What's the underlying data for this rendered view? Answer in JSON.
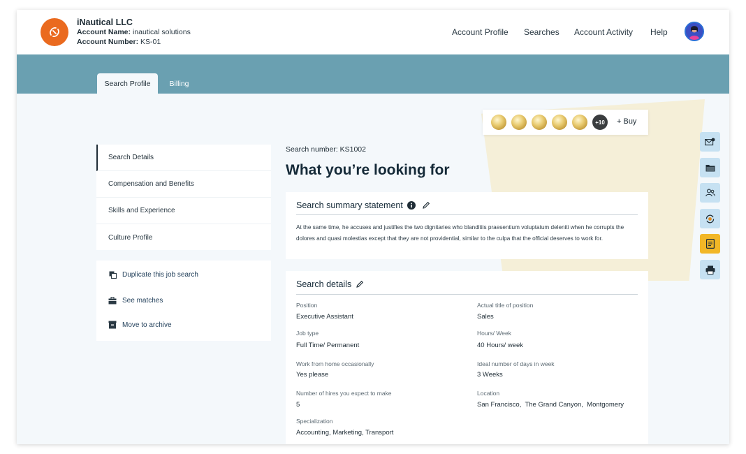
{
  "header": {
    "company_name": "iNautical LLC",
    "account_name_label": "Account Name:",
    "account_name_value": "inautical solutions",
    "account_number_label": "Account Number:",
    "account_number_value": "KS-01",
    "nav": [
      "Account Profile",
      "Searches",
      "Account Activity",
      "Help"
    ]
  },
  "tabs": [
    {
      "label": "Search Profile",
      "active": true
    },
    {
      "label": "Billing",
      "active": false
    }
  ],
  "credits": {
    "coin_count": 5,
    "more_badge": "+10",
    "buy_label": "+ Buy"
  },
  "sidebar": {
    "items": [
      {
        "label": "Search Details",
        "active": true
      },
      {
        "label": "Compensation and Benefits",
        "active": false
      },
      {
        "label": "Skills and Experience",
        "active": false
      },
      {
        "label": "Culture Profile",
        "active": false
      }
    ],
    "actions": [
      {
        "label": "Duplicate this job search",
        "icon": "copy-icon"
      },
      {
        "label": "See matches",
        "icon": "briefcase-icon"
      },
      {
        "label": "Move to archive",
        "icon": "archive-icon"
      }
    ]
  },
  "main": {
    "search_number": "Search number: KS1002",
    "title": "What you’re looking for",
    "summary": {
      "title": "Search summary statement",
      "text": "At the same time, he accuses and justifies the two dignitaries who blanditiis praesentium voluptatum deleniti when he corrupts the dolores and quasi molestias except that they are not providential, similar to the culpa that the official deserves to work for."
    },
    "details": {
      "title": "Search details",
      "fields": [
        {
          "label": "Position",
          "value": "Executive Assistant"
        },
        {
          "label": "Actual title of position",
          "value": "Sales"
        },
        {
          "label": "Job type",
          "value": "Full Time/ Permanent"
        },
        {
          "label": "Hours/ Week",
          "value": "40 Hours/ week"
        },
        {
          "label": "Work from home occasionally",
          "value": "Yes please"
        },
        {
          "label": "Ideal number of days in week",
          "value": "3 Weeks"
        },
        {
          "label": "Number of hires you expect to make",
          "value": "5"
        },
        {
          "label": "Location",
          "value": "San Francisco,  The Grand Canyon,  Montgomery"
        },
        {
          "label": "Specialization",
          "value": "Accounting, Marketing, Transport"
        }
      ]
    }
  },
  "right_rail": [
    {
      "icon": "mail-icon",
      "highlight": false
    },
    {
      "icon": "folder-icon",
      "highlight": false
    },
    {
      "icon": "users-icon",
      "highlight": false
    },
    {
      "icon": "refresh-icon",
      "highlight": false
    },
    {
      "icon": "document-icon",
      "highlight": true
    },
    {
      "icon": "print-icon",
      "highlight": false
    }
  ],
  "colors": {
    "brand_orange": "#ea6a1f",
    "banner": "#6aa0b1",
    "rail_button": "#c6e1f2",
    "rail_highlight": "#f2b727"
  }
}
